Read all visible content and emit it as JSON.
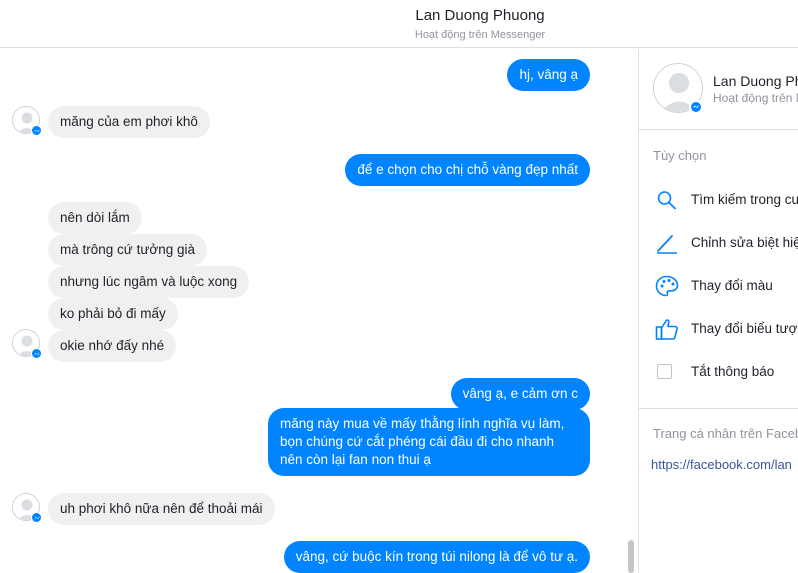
{
  "header": {
    "name": "Lan Duong Phuong",
    "status": "Hoạt động trên Messenger"
  },
  "messages": [
    {
      "dir": "out",
      "text": "hj, vâng ạ"
    },
    {
      "dir": "in",
      "text": "măng của em phơi khô"
    },
    {
      "dir": "out",
      "text": "để e chọn cho chị chỗ vàng đẹp nhất"
    },
    {
      "dir": "in",
      "text": "nên dòi lắm"
    },
    {
      "dir": "in",
      "text": "mà trông cứ tưởng già"
    },
    {
      "dir": "in",
      "text": "nhưng lúc ngâm và luộc xong"
    },
    {
      "dir": "in",
      "text": "ko phải bỏ đi mấy"
    },
    {
      "dir": "in",
      "text": "okie nhớ đấy nhé"
    },
    {
      "dir": "out",
      "text": "vâng ạ, e cảm ơn c"
    },
    {
      "dir": "out",
      "text": "măng này mua về mấy thằng lính nghĩa vụ làm, bọn chúng cứ cắt phéng cái đầu đi cho nhanh nên còn lại fan non thui ạ"
    },
    {
      "dir": "in",
      "text": "uh phơi khô nữa nên để thoải mái"
    },
    {
      "dir": "out",
      "text": "vâng, cứ buộc kín trong túi nilong là để vô tư ạ."
    }
  ],
  "panel": {
    "name": "Lan Duong Phuong",
    "status": "Hoạt động trên Messenger",
    "options_title": "Tùy chọn",
    "options": [
      {
        "icon": "search-icon",
        "label": "Tìm kiếm trong cuộc trò chuyện"
      },
      {
        "icon": "pencil-icon",
        "label": "Chỉnh sửa biệt hiệu"
      },
      {
        "icon": "palette-icon",
        "label": "Thay đổi màu"
      },
      {
        "icon": "thumbs-up-icon",
        "label": "Thay đổi biểu tượng cảm xúc"
      },
      {
        "icon": "checkbox",
        "label": "Tắt thông báo"
      }
    ],
    "profile_title": "Trang cá nhân trên Facebook",
    "profile_link": "https://facebook.com/lan"
  },
  "colors": {
    "accent": "#0084ff",
    "incoming_bubble": "#f1f0f0",
    "link": "#365899"
  }
}
